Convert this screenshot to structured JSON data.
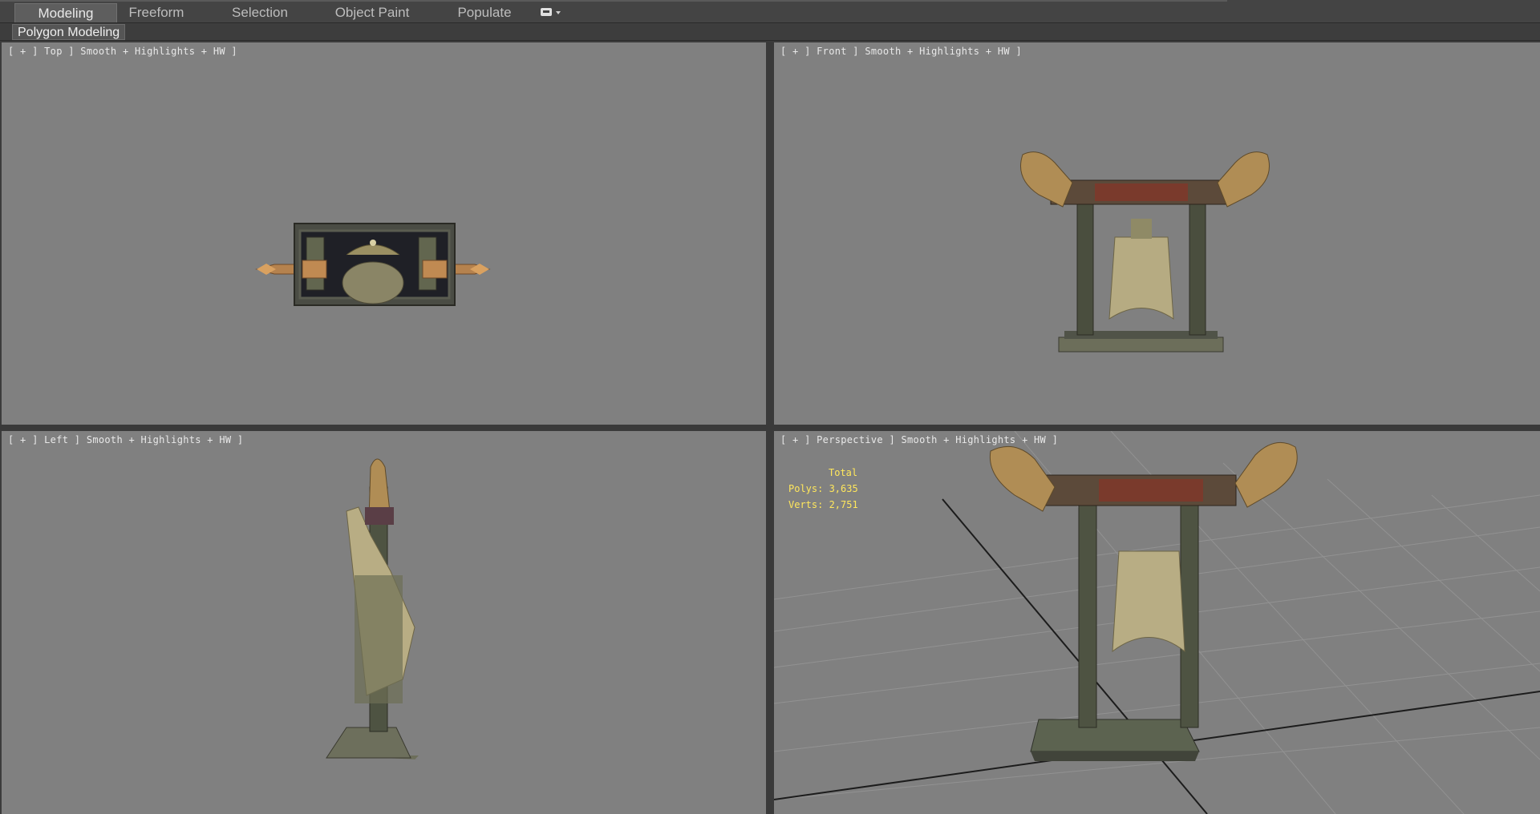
{
  "ribbon": {
    "tabs": [
      {
        "label": "Modeling",
        "active": true
      },
      {
        "label": "Freeform",
        "active": false
      },
      {
        "label": "Selection",
        "active": false
      },
      {
        "label": "Object Paint",
        "active": false
      },
      {
        "label": "Populate",
        "active": false
      }
    ],
    "options_icon": "ribbon-options-icon"
  },
  "subribbon": {
    "label": "Polygon Modeling"
  },
  "viewports": {
    "top": {
      "label": "[ + ] Top ] Smooth + Highlights + HW ]"
    },
    "front": {
      "label": "[ + ] Front ] Smooth + Highlights + HW ]"
    },
    "left": {
      "label": "[ + ] Left ] Smooth + Highlights + HW ]"
    },
    "perspective": {
      "label": "[ + ] Perspective ] Smooth + Highlights + HW ]",
      "stats": {
        "total_label": "Total",
        "polys": "Polys: 3,635",
        "verts": "Verts: 2,751"
      }
    }
  },
  "colors": {
    "viewport_bg": "#808080",
    "stats_text": "#ffe75c",
    "bronze": "#b08d55",
    "dark_stone": "#3a3d34"
  }
}
